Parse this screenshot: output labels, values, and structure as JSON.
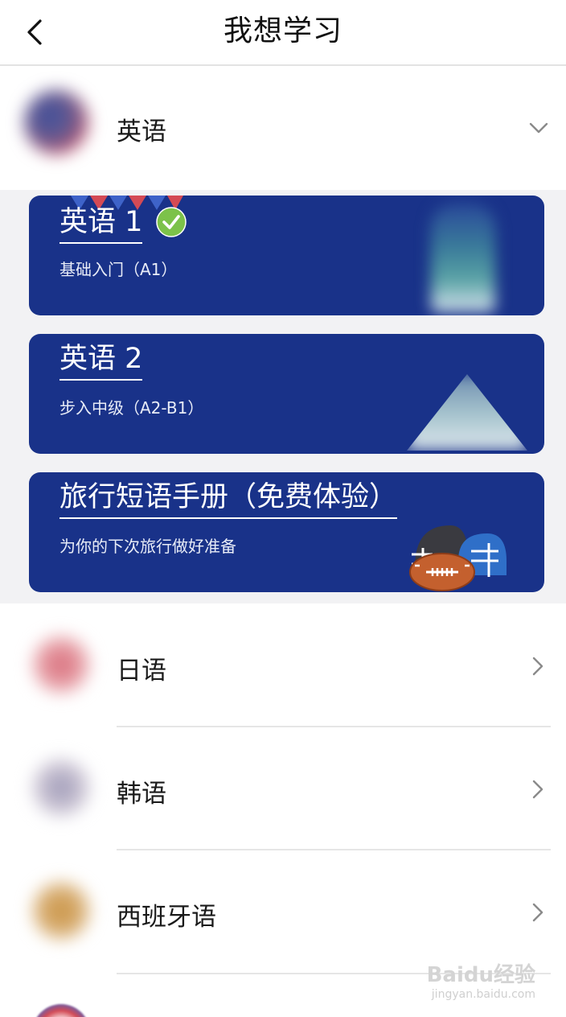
{
  "nav": {
    "title": "我想学习",
    "back_icon": "chevron-left-icon"
  },
  "languages": [
    {
      "label": "英语",
      "state": "expanded",
      "chevron": "chevron-down-icon"
    },
    {
      "label": "日语",
      "state": "collapsed",
      "chevron": "chevron-right-icon"
    },
    {
      "label": "韩语",
      "state": "collapsed",
      "chevron": "chevron-right-icon"
    },
    {
      "label": "西班牙语",
      "state": "collapsed",
      "chevron": "chevron-right-icon"
    }
  ],
  "english_courses": [
    {
      "title": "英语 1",
      "subtitle": "基础入门（A1）",
      "completed": true
    },
    {
      "title": "英语 2",
      "subtitle": "步入中级（A2-B1）",
      "completed": false
    },
    {
      "title": "旅行短语手册（免费体验）",
      "subtitle": "为你的下次旅行做好准备",
      "completed": false
    }
  ],
  "colors": {
    "card_bg": "#193289",
    "check_green": "#7cc24a",
    "expanded_bg": "#f2f2f4"
  },
  "watermark": {
    "brand": "Baidu经验",
    "url": "jingyan.baidu.com"
  }
}
